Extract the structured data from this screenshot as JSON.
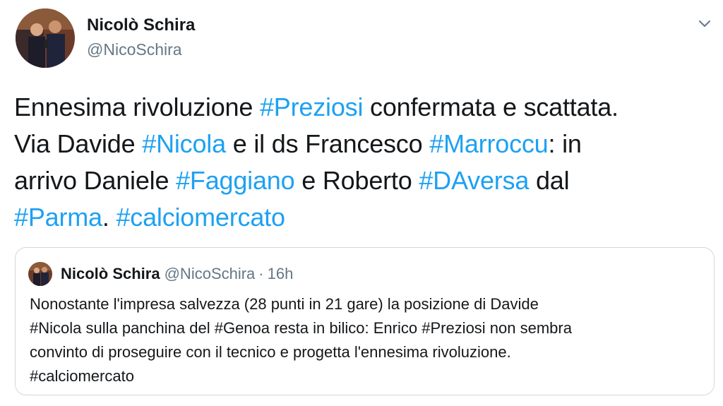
{
  "author": {
    "name": "Nicolò Schira",
    "handle": "@NicoSchira"
  },
  "icons": {
    "menu": "chevron-down-icon",
    "avatar": "avatar-photo"
  },
  "colors": {
    "hashtag": "#1da1f2",
    "secondary_text": "#657786",
    "border": "#cfd9de"
  },
  "tweet": {
    "lines": [
      [
        {
          "text": "Ennesima rivoluzione ",
          "hashtag": false
        },
        {
          "text": "#Preziosi",
          "hashtag": true
        },
        {
          "text": " confermata e scattata.",
          "hashtag": false
        }
      ],
      [
        {
          "text": "Via Davide ",
          "hashtag": false
        },
        {
          "text": "#Nicola",
          "hashtag": true
        },
        {
          "text": " e il ds Francesco ",
          "hashtag": false
        },
        {
          "text": "#Marroccu",
          "hashtag": true
        },
        {
          "text": ": in",
          "hashtag": false
        }
      ],
      [
        {
          "text": "arrivo Daniele ",
          "hashtag": false
        },
        {
          "text": "#Faggiano",
          "hashtag": true
        },
        {
          "text": " e Roberto ",
          "hashtag": false
        },
        {
          "text": "#DAversa",
          "hashtag": true
        },
        {
          "text": " dal",
          "hashtag": false
        }
      ],
      [
        {
          "text": "#Parma",
          "hashtag": true
        },
        {
          "text": ". ",
          "hashtag": false
        },
        {
          "text": "#calciomercato",
          "hashtag": true
        }
      ]
    ]
  },
  "quoted_tweet": {
    "name": "Nicolò Schira",
    "handle": "@NicoSchira",
    "separator": "·",
    "time": "16h",
    "lines": [
      "Nonostante l'impresa salvezza (28 punti in 21 gare) la posizione di Davide",
      "#Nicola sulla panchina del #Genoa resta in bilico: Enrico #Preziosi non sembra",
      "convinto di proseguire con il tecnico e progetta l'ennesima rivoluzione.",
      "#calciomercato"
    ]
  }
}
